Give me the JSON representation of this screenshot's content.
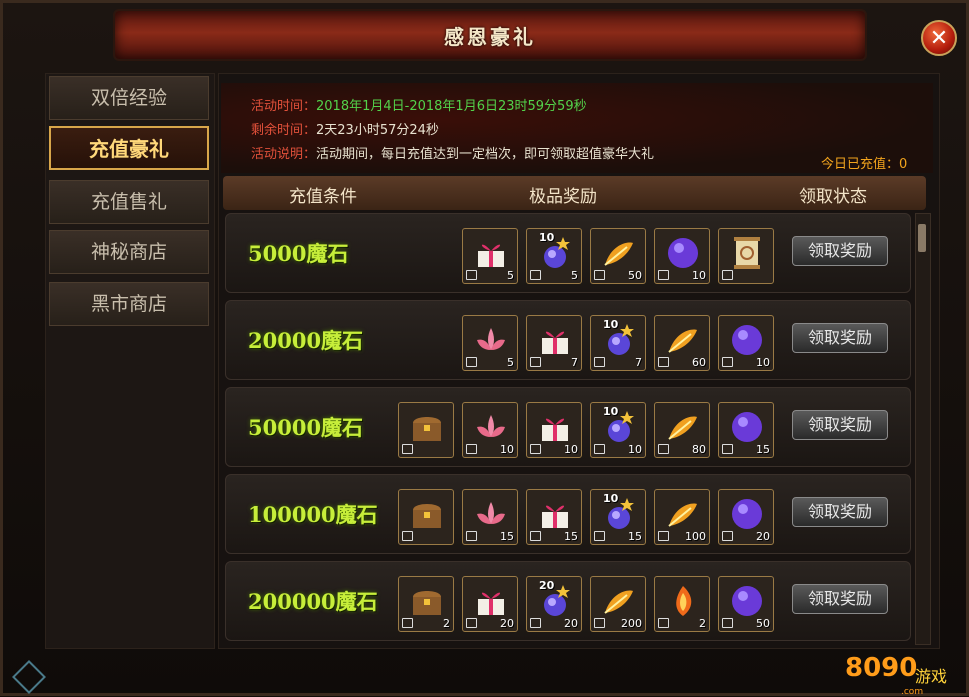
{
  "window": {
    "title": "感恩豪礼",
    "close": "✕"
  },
  "sidebar": {
    "items": [
      {
        "label": "双倍经验",
        "active": false
      },
      {
        "label": "充值豪礼",
        "active": true
      },
      {
        "label": "充值售礼",
        "active": false
      },
      {
        "label": "神秘商店",
        "active": false
      },
      {
        "label": "黑市商店",
        "active": false
      }
    ]
  },
  "info": {
    "time_label": "活动时间：",
    "time_value": "2018年1月4日-2018年1月6日23时59分59秒",
    "remain_label": "剩余时间：",
    "remain_value": "2天23小时57分24秒",
    "desc_label": "活动说明：",
    "desc_value": "活动期间，每日充值达到一定档次，即可领取超值豪华大礼",
    "today_label": "今日已充值：",
    "today_value": "0"
  },
  "table": {
    "headers": [
      "充值条件",
      "极品奖励",
      "领取状态"
    ],
    "claim_label": "领取奖励",
    "rows": [
      {
        "condition": "5000魔石",
        "items": [
          {
            "icon": "gift-box",
            "count": "5"
          },
          {
            "icon": "soul-orb",
            "count": "5",
            "badge": "10"
          },
          {
            "icon": "feather",
            "count": "50"
          },
          {
            "icon": "exp-orb",
            "count": "10"
          },
          {
            "icon": "scroll",
            "count": ""
          }
        ]
      },
      {
        "condition": "20000魔石",
        "items": [
          {
            "icon": "lotus",
            "count": "5"
          },
          {
            "icon": "gift-box",
            "count": "7"
          },
          {
            "icon": "soul-orb",
            "count": "7",
            "badge": "10"
          },
          {
            "icon": "feather",
            "count": "60"
          },
          {
            "icon": "exp-orb",
            "count": "10"
          }
        ]
      },
      {
        "condition": "50000魔石",
        "items": [
          {
            "icon": "treasure-chest",
            "count": ""
          },
          {
            "icon": "lotus",
            "count": "10"
          },
          {
            "icon": "gift-box",
            "count": "10"
          },
          {
            "icon": "soul-orb",
            "count": "10",
            "badge": "10"
          },
          {
            "icon": "feather",
            "count": "80"
          },
          {
            "icon": "exp-orb",
            "count": "15"
          }
        ]
      },
      {
        "condition": "100000魔石",
        "items": [
          {
            "icon": "treasure-chest",
            "count": ""
          },
          {
            "icon": "lotus",
            "count": "15"
          },
          {
            "icon": "gift-box",
            "count": "15"
          },
          {
            "icon": "soul-orb",
            "count": "15",
            "badge": "10"
          },
          {
            "icon": "feather",
            "count": "100"
          },
          {
            "icon": "exp-orb",
            "count": "20"
          }
        ]
      },
      {
        "condition": "200000魔石",
        "items": [
          {
            "icon": "treasure-chest",
            "count": "2"
          },
          {
            "icon": "gift-box",
            "count": "20"
          },
          {
            "icon": "soul-orb",
            "count": "20",
            "badge": "20"
          },
          {
            "icon": "feather",
            "count": "200"
          },
          {
            "icon": "flame-feather",
            "count": "2"
          },
          {
            "icon": "exp-orb",
            "count": "50"
          }
        ]
      }
    ]
  },
  "watermark": {
    "logo": "8090",
    "logo_text": "游戏",
    "domain": ".com"
  }
}
